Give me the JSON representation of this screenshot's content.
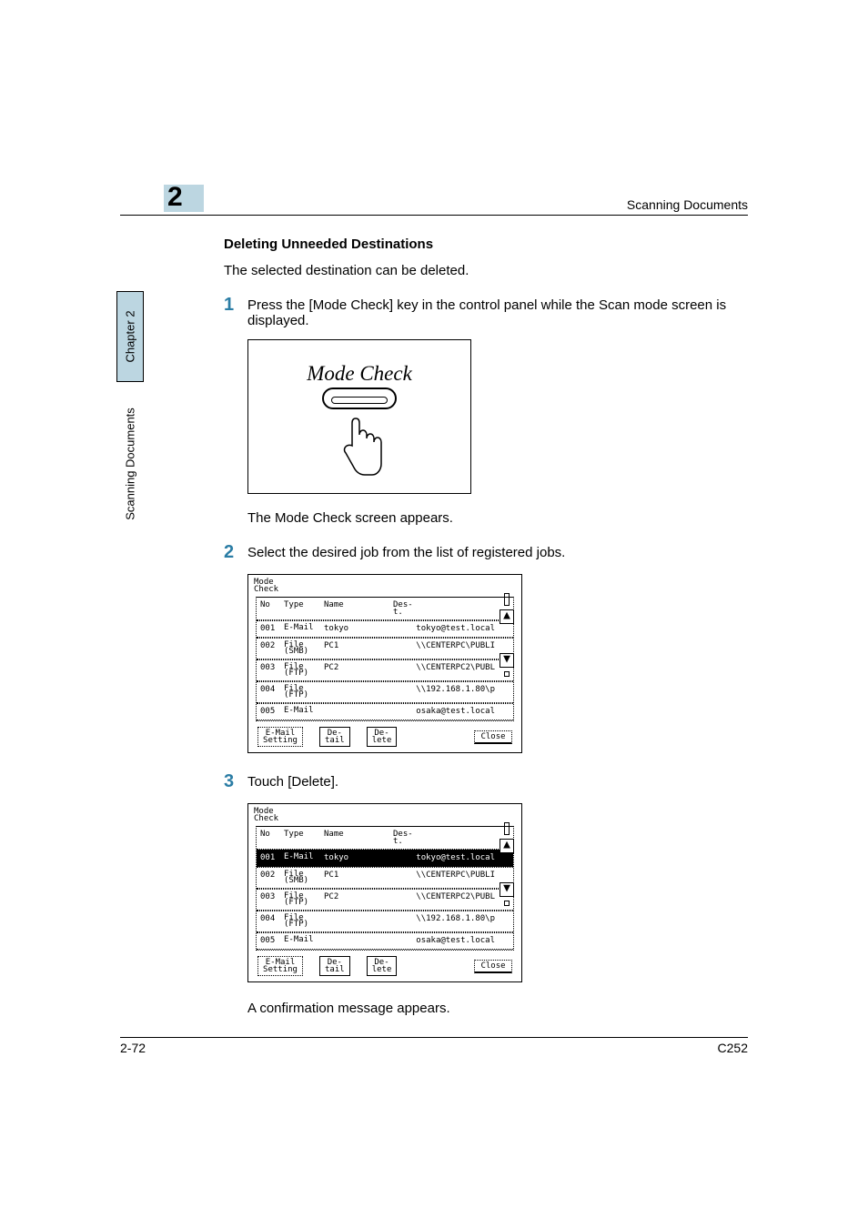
{
  "header": {
    "right": "Scanning Documents",
    "chapter_number": "2"
  },
  "sidebar": {
    "chapter": "Chapter 2",
    "label": "Scanning Documents"
  },
  "section": {
    "title": "Deleting Unneeded Destinations",
    "intro": "The selected destination can be deleted."
  },
  "steps": {
    "s1num": "1",
    "s1text": "Press the [Mode Check] key in the control panel while the Scan mode screen is displayed.",
    "fig1_label": "Mode Check",
    "s1after": "The Mode Check screen appears.",
    "s2num": "2",
    "s2text": "Select the desired job from the list of registered jobs.",
    "s3num": "3",
    "s3text": "Touch [Delete].",
    "s3after": "A confirmation message appears."
  },
  "screen": {
    "title_l1": "Mode",
    "title_l2": "Check",
    "head_no": "No",
    "head_type": "Type",
    "head_name": "Name",
    "head_dest_l1": "Des-",
    "head_dest_l2": "t.",
    "rows": [
      {
        "no": "001",
        "type": "E-Mail",
        "name": "tokyo",
        "dest": "tokyo@test.local"
      },
      {
        "no": "002",
        "type": "File\n(SMB)",
        "name": "PC1",
        "dest": "\\\\CENTERPC\\PUBLI"
      },
      {
        "no": "003",
        "type": "File\n(FTP)",
        "name": "PC2",
        "dest": "\\\\CENTERPC2\\PUBL"
      },
      {
        "no": "004",
        "type": "File\n(FTP)",
        "name": "",
        "dest": "\\\\192.168.1.80\\p"
      },
      {
        "no": "005",
        "type": "E-Mail",
        "name": "",
        "dest": "osaka@test.local"
      }
    ],
    "arrow_up": "▲",
    "arrow_down": "▼",
    "btn_email_l1": "E-Mail",
    "btn_email_l2": "Setting",
    "btn_detail_l1": "De-",
    "btn_detail_l2": "tail",
    "btn_delete_l1": "De-",
    "btn_delete_l2": "lete",
    "btn_close": "Close"
  },
  "footer": {
    "left": "2-72",
    "right": "C252"
  }
}
